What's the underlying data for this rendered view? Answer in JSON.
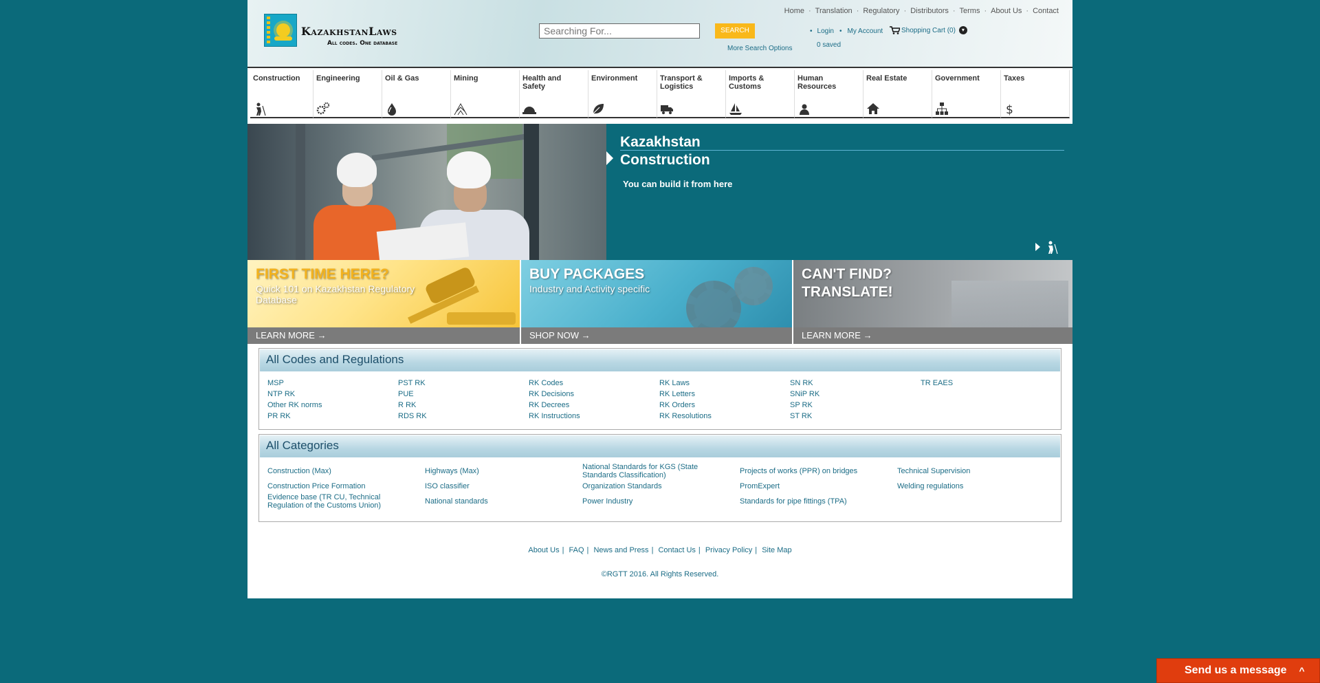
{
  "brand": {
    "name": "KazakhstanLaws",
    "tagline": "All codes. One database"
  },
  "search": {
    "placeholder": "Searching For...",
    "button": "SEARCH",
    "more": "More Search Options"
  },
  "topnav": [
    "Home",
    "Translation",
    "Regulatory",
    "Distributors",
    "Terms",
    "About Us",
    "Contact"
  ],
  "account": {
    "login": "Login",
    "my_account": "My Account",
    "cart": "Shopping Cart (0)",
    "saved": "0 saved"
  },
  "categories": [
    {
      "label": "Construction",
      "icon": "surveyor-icon"
    },
    {
      "label": "Engineering",
      "icon": "gears-icon"
    },
    {
      "label": "Oil & Gas",
      "icon": "drop-icon"
    },
    {
      "label": "Mining",
      "icon": "mine-icon"
    },
    {
      "label": "Health and Safety",
      "icon": "hardhat-icon"
    },
    {
      "label": "Environment",
      "icon": "leaf-icon"
    },
    {
      "label": "Transport & Logistics",
      "icon": "truck-icon"
    },
    {
      "label": "Imports & Customs",
      "icon": "ship-icon"
    },
    {
      "label": "Human Resources",
      "icon": "person-icon"
    },
    {
      "label": "Real Estate",
      "icon": "house-icon"
    },
    {
      "label": "Government",
      "icon": "org-chart-icon"
    },
    {
      "label": "Taxes",
      "icon": "dollar-icon"
    }
  ],
  "slider": {
    "title_line1": "Kazakhstan",
    "title_line2": "Construction",
    "subtitle": "You can build it from here"
  },
  "promos": [
    {
      "title": "FIRST TIME HERE?",
      "subtitle": "Quick 101 on Kazakhstan Regulatory Database",
      "cta": "LEARN MORE →"
    },
    {
      "title": "BUY PACKAGES",
      "subtitle": "Industry and Activity specific",
      "cta": "SHOP NOW →"
    },
    {
      "title_line1": "CAN'T FIND?",
      "title_line2": "TRANSLATE!",
      "cta": "LEARN MORE →"
    }
  ],
  "codes": {
    "heading": "All Codes and Regulations",
    "items": [
      "MSP",
      "NTP RK",
      "Other RK norms",
      "PR RK",
      "PST RK",
      "PUE",
      "R RK",
      "RDS RK",
      "RK Codes",
      "RK Decisions",
      "RK Decrees",
      "RK Instructions",
      "RK Laws",
      "RK Letters",
      "RK Orders",
      "RK Resolutions",
      "SN RK",
      "SNiP RK",
      "SP RK",
      "ST RK",
      "TR EAES"
    ]
  },
  "all_categories": {
    "heading": "All Categories",
    "items": [
      "Construction (Max)",
      "Construction Price Formation",
      "Evidence base (TR CU, Technical Regulation of the Customs Union)",
      "Highways (Max)",
      "ISO classifier",
      "National standards",
      "National Standards for KGS (State Standards Classification)",
      "Organization Standards",
      "Power Industry",
      "Projects of works (PPR) on bridges",
      "PromExpert",
      "Standards for pipe fittings (TPA)",
      "Technical Supervision",
      "Welding regulations"
    ]
  },
  "footer": {
    "links": [
      "About Us",
      "FAQ",
      "News and Press",
      "Contact Us",
      "Privacy Policy",
      "Site Map"
    ],
    "copyright": "©RGTT 2016. All Rights Reserved."
  },
  "chat": {
    "label": "Send us a message"
  }
}
